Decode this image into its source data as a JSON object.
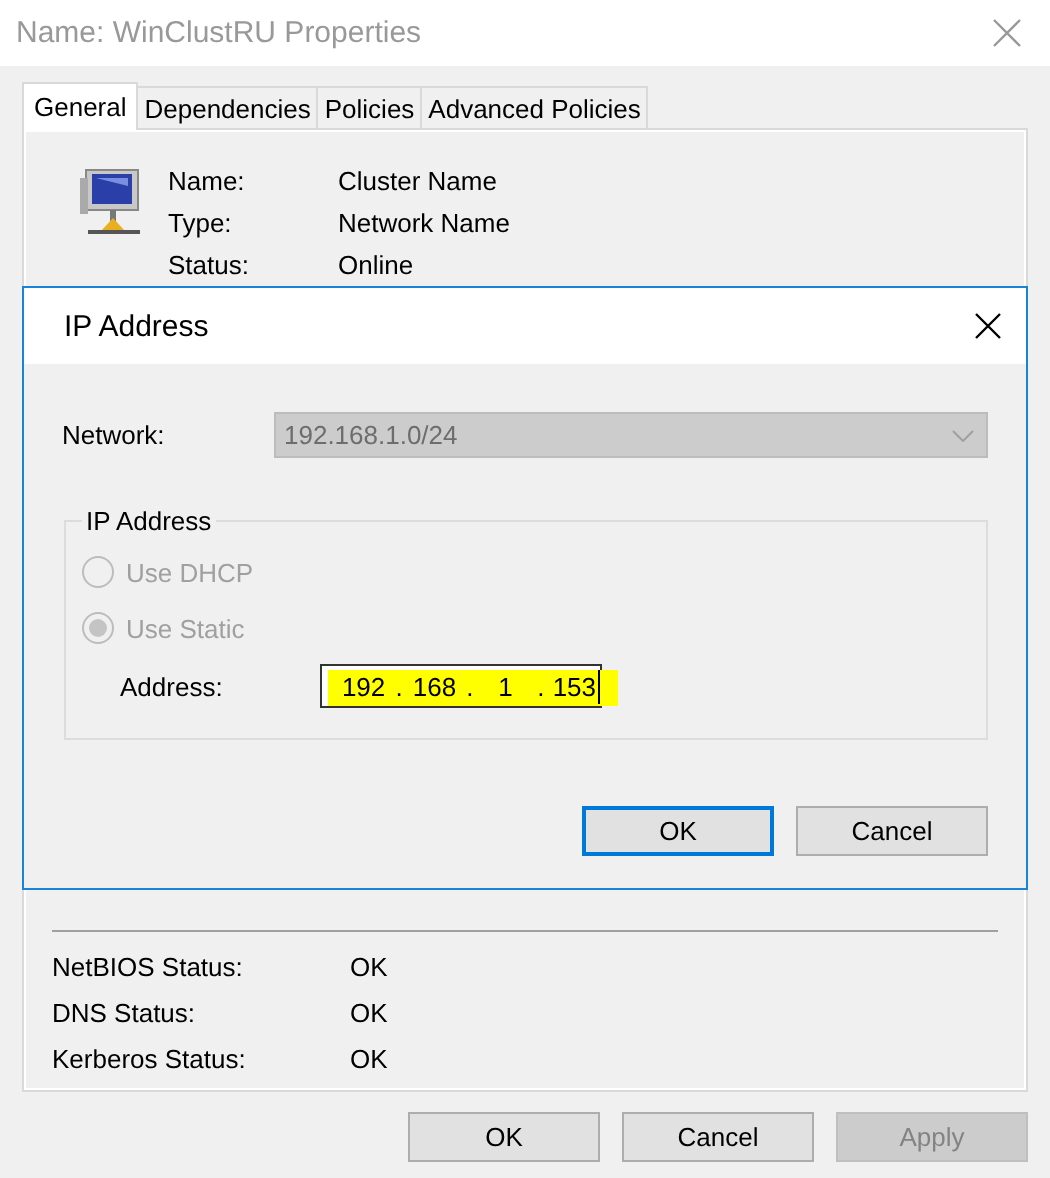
{
  "window": {
    "title": "Name: WinClustRU Properties"
  },
  "tabs": [
    {
      "label": "General",
      "selected": true
    },
    {
      "label": "Dependencies",
      "selected": false
    },
    {
      "label": "Policies",
      "selected": false
    },
    {
      "label": "Advanced Policies",
      "selected": false
    }
  ],
  "general": {
    "fields": [
      {
        "label": "Name:",
        "value": "Cluster Name"
      },
      {
        "label": "Type:",
        "value": "Network Name"
      },
      {
        "label": "Status:",
        "value": "Online"
      }
    ],
    "statuses": [
      {
        "label": "NetBIOS Status:",
        "value": "OK"
      },
      {
        "label": "DNS Status:",
        "value": "OK"
      },
      {
        "label": "Kerberos Status:",
        "value": "OK"
      }
    ]
  },
  "buttons": [
    {
      "label": "OK",
      "disabled": false
    },
    {
      "label": "Cancel",
      "disabled": false
    },
    {
      "label": "Apply",
      "disabled": true
    }
  ],
  "dialog": {
    "title": "IP Address",
    "network": {
      "label": "Network:",
      "value": "192.168.1.0/24",
      "disabled": true
    },
    "group": {
      "title": "IP Address",
      "options": [
        {
          "label": "Use DHCP",
          "selected": false,
          "disabled": true
        },
        {
          "label": "Use Static",
          "selected": true,
          "disabled": true
        }
      ],
      "address": {
        "label": "Address:",
        "octets": [
          "192",
          "168",
          "1",
          "153"
        ],
        "separator": ".",
        "highlighted": true
      }
    },
    "buttons": [
      {
        "label": "OK",
        "default": true
      },
      {
        "label": "Cancel",
        "default": false
      }
    ]
  }
}
